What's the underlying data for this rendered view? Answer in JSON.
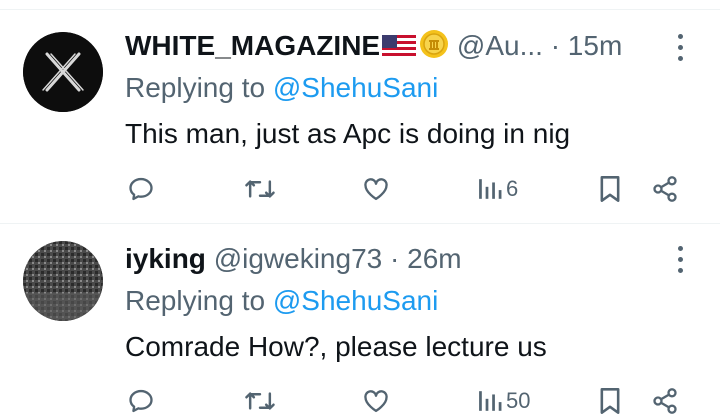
{
  "posts": [
    {
      "author_name": "WHITE_MAGAZINE",
      "handle": "@Au...",
      "separator": "·",
      "time": "15m",
      "replying_label": "Replying to",
      "replying_to": "@ShehuSani",
      "text": "This man, just as Apc is doing in nig",
      "views": "6",
      "avatar": "x-logo-avatar",
      "badges": [
        "us-flag-emoji",
        "coin-emoji"
      ]
    },
    {
      "author_name": "iyking",
      "handle": "@igweking73",
      "separator": "·",
      "time": "26m",
      "replying_label": "Replying to",
      "replying_to": "@ShehuSani",
      "text": "Comrade How?, please lecture us",
      "views": "50",
      "avatar": "photo-avatar",
      "badges": []
    }
  ],
  "icons": [
    "reply-icon",
    "retweet-icon",
    "like-icon",
    "views-icon",
    "bookmark-icon",
    "share-icon",
    "more-icon"
  ],
  "colors": {
    "text": "#0f1419",
    "secondary": "#536471",
    "link": "#1d9bf0",
    "divider": "#eff3f4"
  }
}
